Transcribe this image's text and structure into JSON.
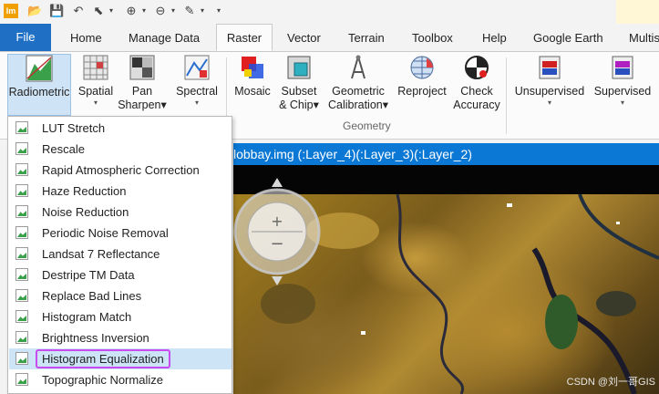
{
  "app": {
    "logo_text": "lm"
  },
  "tabs": {
    "file": "File",
    "items": [
      "Home",
      "Manage Data",
      "Raster",
      "Vector",
      "Terrain",
      "Toolbox",
      "Help",
      "Google Earth",
      "Multis"
    ]
  },
  "ribbon": {
    "radiometric": "Radiometric",
    "spatial": "Spatial",
    "pan_sharpen_1": "Pan",
    "pan_sharpen_2": "Sharpen",
    "spectral": "Spectral",
    "mosaic": "Mosaic",
    "subset_1": "Subset",
    "subset_2": "& Chip",
    "geocal_1": "Geometric",
    "geocal_2": "Calibration",
    "reproject": "Reproject",
    "check_1": "Check",
    "check_2": "Accuracy",
    "geometry_group": "Geometry",
    "unsupervised": "Unsupervised",
    "supervised": "Supervised"
  },
  "viewer": {
    "title": "lobbay.img (:Layer_4)(:Layer_3)(:Layer_2)"
  },
  "menu": {
    "items": [
      "LUT Stretch",
      "Rescale",
      "Rapid Atmospheric Correction",
      "Haze Reduction",
      "Noise Reduction",
      "Periodic Noise Removal",
      "Landsat 7 Reflectance",
      "Destripe TM Data",
      "Replace Bad Lines",
      "Histogram Match",
      "Brightness Inversion",
      "Histogram Equalization",
      "Topographic Normalize"
    ],
    "selected_index": 11
  },
  "watermark": "CSDN @刘一哥GIS",
  "colors": {
    "file_tab": "#1f6fc5",
    "viewer_title": "#0a78d4",
    "selection_outline": "#c84cf0"
  }
}
